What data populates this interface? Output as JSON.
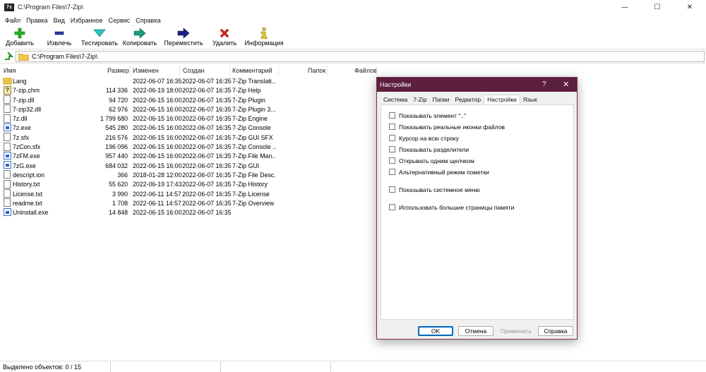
{
  "window": {
    "icon_text": "7z",
    "title": "C:\\Program Files\\7-Zip\\",
    "minimize": "—",
    "maximize": "☐",
    "close": "✕"
  },
  "menu": [
    "Файл",
    "Правка",
    "Вид",
    "Избранное",
    "Сервис",
    "Справка"
  ],
  "toolbar": [
    {
      "label": "Добавить",
      "icon": "plus-icon",
      "color": "#1db31d"
    },
    {
      "label": "Извлечь",
      "icon": "minus-icon",
      "color": "#2c3a9e"
    },
    {
      "label": "Тестировать",
      "icon": "test-check-icon",
      "color": "#2ec4c4"
    },
    {
      "label": "Копировать",
      "icon": "copy-arrow-icon",
      "color": "#1a9a7a"
    },
    {
      "label": "Переместить",
      "icon": "move-arrow-icon",
      "color": "#1a237e"
    },
    {
      "label": "Удалить",
      "icon": "delete-x-icon",
      "color": "#d81e1e"
    },
    {
      "label": "Информация",
      "icon": "info-icon",
      "color": "#c9b400"
    }
  ],
  "address": {
    "path": "C:\\Program Files\\7-Zip\\"
  },
  "columns": {
    "name": "Имя",
    "size": "Размер",
    "modified": "Изменен",
    "created": "Создан",
    "comment": "Комментарий",
    "folders": "Папок",
    "files": "Файлов"
  },
  "files": [
    {
      "name": "Lang",
      "size": "",
      "modified": "2022-06-07 16:35",
      "created": "2022-06-07 16:35",
      "comment": "7-Zip Translati...",
      "icon": "folder"
    },
    {
      "name": "7-zip.chm",
      "size": "114 336",
      "modified": "2022-06-19 18:00",
      "created": "2022-06-07 16:35",
      "comment": "7-Zip Help",
      "icon": "chm"
    },
    {
      "name": "7-zip.dll",
      "size": "94 720",
      "modified": "2022-06-15 16:00",
      "created": "2022-06-07 16:35",
      "comment": "7-Zip Plugin",
      "icon": "file"
    },
    {
      "name": "7-zip32.dll",
      "size": "62 976",
      "modified": "2022-06-15 16:00",
      "created": "2022-06-07 16:35",
      "comment": "7-Zip Plugin 3...",
      "icon": "file"
    },
    {
      "name": "7z.dll",
      "size": "1 799 680",
      "modified": "2022-06-15 16:00",
      "created": "2022-06-07 16:35",
      "comment": "7-Zip Engine",
      "icon": "file"
    },
    {
      "name": "7z.exe",
      "size": "545 280",
      "modified": "2022-06-15 16:00",
      "created": "2022-06-07 16:35",
      "comment": "7-Zip Console",
      "icon": "exe"
    },
    {
      "name": "7z.sfx",
      "size": "216 576",
      "modified": "2022-06-15 16:00",
      "created": "2022-06-07 16:35",
      "comment": "7-Zip GUI SFX",
      "icon": "file"
    },
    {
      "name": "7zCon.sfx",
      "size": "196 096",
      "modified": "2022-06-15 16:00",
      "created": "2022-06-07 16:35",
      "comment": "7-Zip Console ...",
      "icon": "file"
    },
    {
      "name": "7zFM.exe",
      "size": "957 440",
      "modified": "2022-06-15 16:00",
      "created": "2022-06-07 16:35",
      "comment": "7-Zip File Man...",
      "icon": "exe"
    },
    {
      "name": "7zG.exe",
      "size": "684 032",
      "modified": "2022-06-15 16:00",
      "created": "2022-06-07 16:35",
      "comment": "7-Zip GUI",
      "icon": "exe"
    },
    {
      "name": "descript.ion",
      "size": "366",
      "modified": "2018-01-28 12:00",
      "created": "2022-06-07 16:35",
      "comment": "7-Zip File Desc...",
      "icon": "file"
    },
    {
      "name": "History.txt",
      "size": "55 620",
      "modified": "2022-06-19 17:43",
      "created": "2022-06-07 16:35",
      "comment": "7-Zip History",
      "icon": "file"
    },
    {
      "name": "License.txt",
      "size": "3 990",
      "modified": "2022-06-11 14:57",
      "created": "2022-06-07 16:35",
      "comment": "7-Zip License",
      "icon": "file"
    },
    {
      "name": "readme.txt",
      "size": "1 708",
      "modified": "2022-06-11 14:57",
      "created": "2022-06-07 16:35",
      "comment": "7-Zip Overview",
      "icon": "file"
    },
    {
      "name": "Uninstall.exe",
      "size": "14 848",
      "modified": "2022-06-15 16:00",
      "created": "2022-06-07 16:35",
      "comment": "",
      "icon": "exe"
    }
  ],
  "status": {
    "text": "Выделено объектов: 0 / 15"
  },
  "dialog": {
    "title": "Настройки",
    "help": "?",
    "close": "✕",
    "tabs": [
      "Система",
      "7-Zip",
      "Папки",
      "Редактор",
      "Настройки",
      "Язык"
    ],
    "active_tab": "Настройки",
    "options": [
      {
        "label": "Показывать элемент \"..\"",
        "checked": false
      },
      {
        "label": "Показывать реальные иконки файлов",
        "checked": false
      },
      {
        "label": "Курсор на всю строку",
        "checked": false
      },
      {
        "label": "Показывать разделители",
        "checked": false
      },
      {
        "label": "Открывать одним щелчком",
        "checked": false
      },
      {
        "label": "Альтернативный режим пометки",
        "checked": false
      },
      {
        "label": "Показывать системное меню",
        "checked": false
      },
      {
        "label": "Использовать большие страницы памяти",
        "checked": false
      }
    ],
    "buttons": {
      "ok": "OK",
      "cancel": "Отмена",
      "apply": "Применить",
      "help": "Справка"
    }
  }
}
